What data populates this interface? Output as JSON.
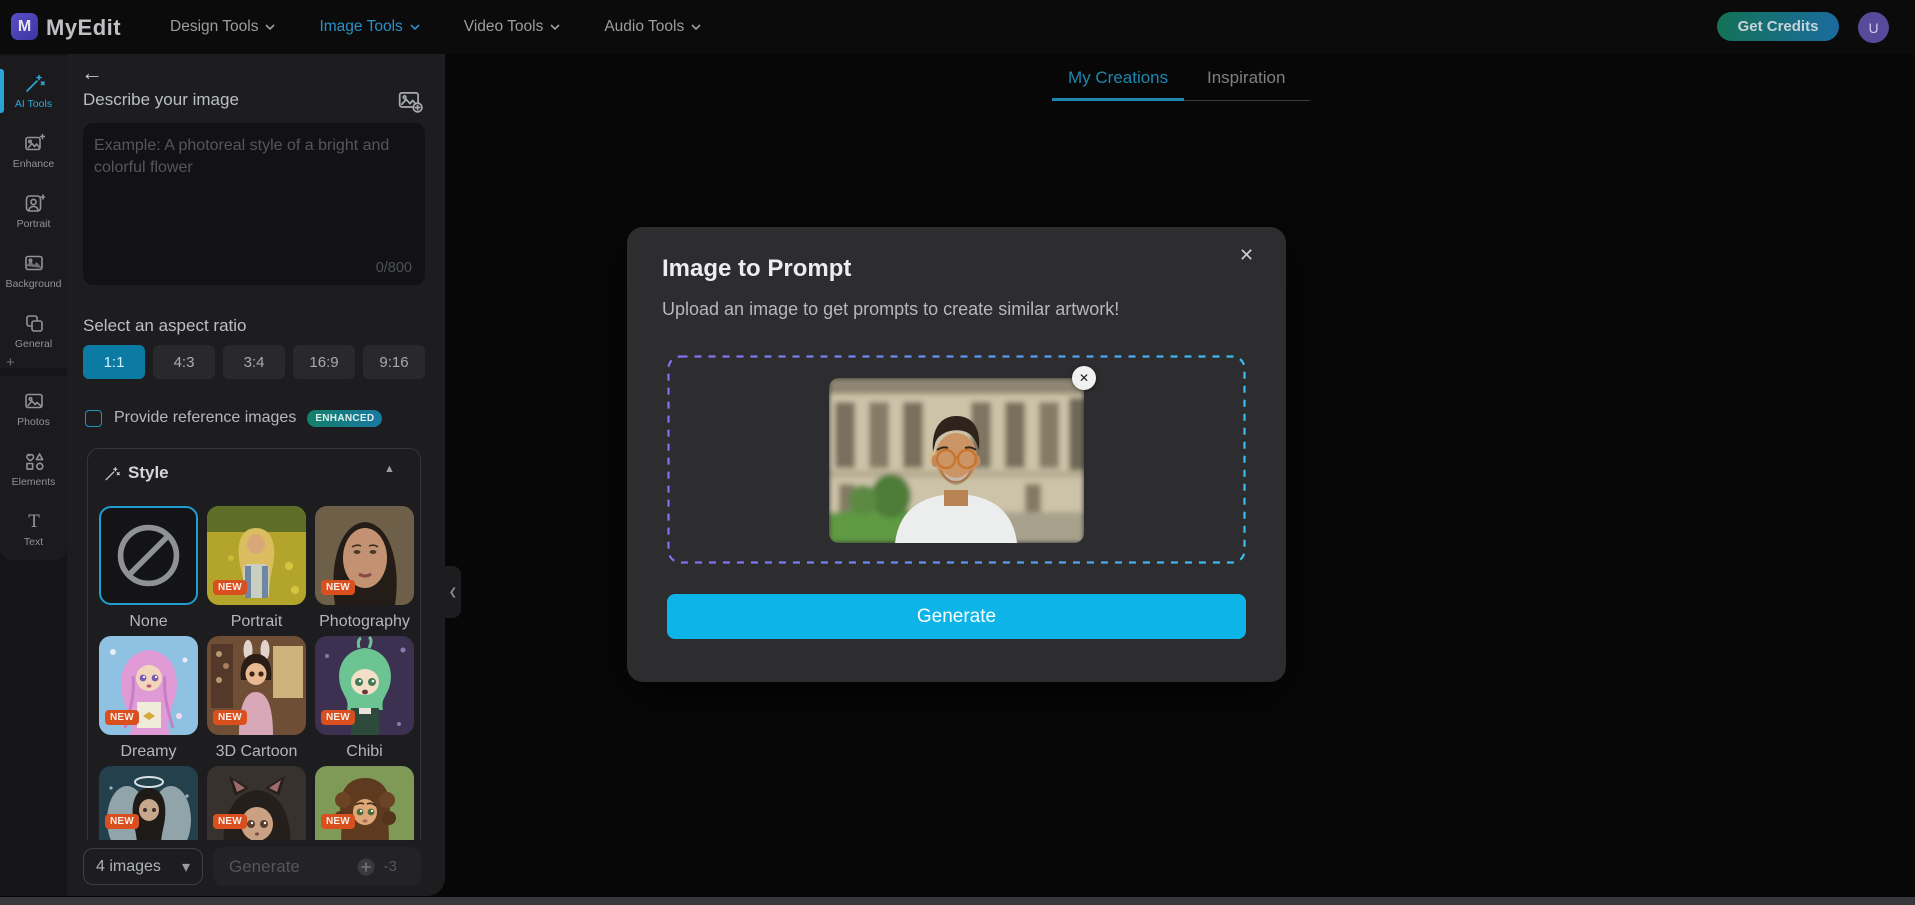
{
  "navbar": {
    "brand": "MyEdit",
    "logo_letter": "M",
    "menus": [
      {
        "label": "Design Tools",
        "active": false
      },
      {
        "label": "Image Tools",
        "active": true
      },
      {
        "label": "Video Tools",
        "active": false
      },
      {
        "label": "Audio Tools",
        "active": false
      }
    ],
    "get_credits": "Get Credits",
    "avatar_initial": "U"
  },
  "rail": {
    "items": [
      {
        "label": "AI Tools",
        "icon": "magic-wand-icon",
        "active": true
      },
      {
        "label": "Enhance",
        "icon": "image-sparkle-icon",
        "active": false
      },
      {
        "label": "Portrait",
        "icon": "portrait-frame-icon",
        "active": false
      },
      {
        "label": "Background",
        "icon": "background-image-icon",
        "active": false
      },
      {
        "label": "General",
        "icon": "layers-icon",
        "active": false
      },
      {
        "label": "Photos",
        "icon": "photo-icon",
        "active": false
      },
      {
        "label": "Elements",
        "icon": "shapes-icon",
        "active": false
      },
      {
        "label": "Text",
        "icon": "text-icon",
        "active": false
      }
    ]
  },
  "panel": {
    "title": "Describe your image",
    "prompt_placeholder": "Example: A photoreal style of a bright and colorful flower",
    "char_count": "0/800",
    "aspect_label": "Select an aspect ratio",
    "ratios": [
      {
        "label": "1:1",
        "selected": true
      },
      {
        "label": "4:3",
        "selected": false
      },
      {
        "label": "3:4",
        "selected": false
      },
      {
        "label": "16:9",
        "selected": false
      },
      {
        "label": "9:16",
        "selected": false
      }
    ],
    "reference_label": "Provide reference images",
    "reference_badge": "ENHANCED",
    "style_title": "Style",
    "styles": [
      {
        "label": "None",
        "badge": "",
        "selected": true
      },
      {
        "label": "Portrait",
        "badge": "NEW",
        "selected": false
      },
      {
        "label": "Photography",
        "badge": "NEW",
        "selected": false
      },
      {
        "label": "Dreamy",
        "badge": "NEW",
        "selected": false
      },
      {
        "label": "3D Cartoon",
        "badge": "NEW",
        "selected": false
      },
      {
        "label": "Chibi",
        "badge": "NEW",
        "selected": false
      },
      {
        "label": "",
        "badge": "NEW",
        "selected": false
      },
      {
        "label": "",
        "badge": "NEW",
        "selected": false
      },
      {
        "label": "",
        "badge": "NEW",
        "selected": false
      }
    ],
    "images_count": "4 images",
    "generate_label": "Generate",
    "credit_cost": "-3"
  },
  "workspace": {
    "tabs": [
      {
        "label": "My Creations",
        "active": true
      },
      {
        "label": "Inspiration",
        "active": false
      }
    ]
  },
  "modal": {
    "title": "Image to Prompt",
    "subtitle": "Upload an image to get prompts to create similar artwork!",
    "generate_label": "Generate"
  },
  "icons": {
    "back": "←",
    "close": "✕",
    "remove": "✕",
    "caret_down": "▾",
    "collapse_up": "▲",
    "panel_collapse": "❮",
    "plus": "+"
  },
  "colors": {
    "accent_cyan": "#0db4e8",
    "tab_active": "#1d87ae",
    "nav_active": "#2b8fc6",
    "rail_active": "#2ea8da",
    "ratio_selected": "#0b7ba3",
    "checkbox_border": "#1f93bb",
    "new_badge": "#d9501e",
    "enhanced_badge_from": "#15806a",
    "enhanced_badge_to": "#1878a2",
    "credits_from": "#147257",
    "credits_to": "#1a6b9e",
    "dropzone_from": "#8a6cf2",
    "dropzone_to": "#37bdf2",
    "avatar_bg": "#584a9a",
    "logo_bg": "#4a3fae"
  }
}
